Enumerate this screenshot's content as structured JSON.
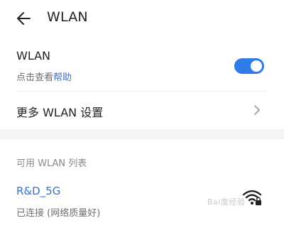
{
  "header": {
    "title": "WLAN",
    "back_icon": "arrow-left-icon"
  },
  "wlan_toggle": {
    "title": "WLAN",
    "sub_prefix": "点击查看",
    "sub_link": "帮助",
    "enabled": true,
    "accent_color": "#2f7be8"
  },
  "more_settings": {
    "label": "更多 WLAN 设置",
    "icon": "chevron-right-icon"
  },
  "available_section": {
    "title": "可用 WLAN 列表"
  },
  "networks": [
    {
      "name": "R&D_5G",
      "status": "已连接 (网络质量好)",
      "icon": "wifi-locked-icon"
    }
  ],
  "watermark": {
    "text": "Bai度经验"
  },
  "colors": {
    "link_blue": "#2f73d9",
    "section_bg": "#f4f4f6"
  }
}
